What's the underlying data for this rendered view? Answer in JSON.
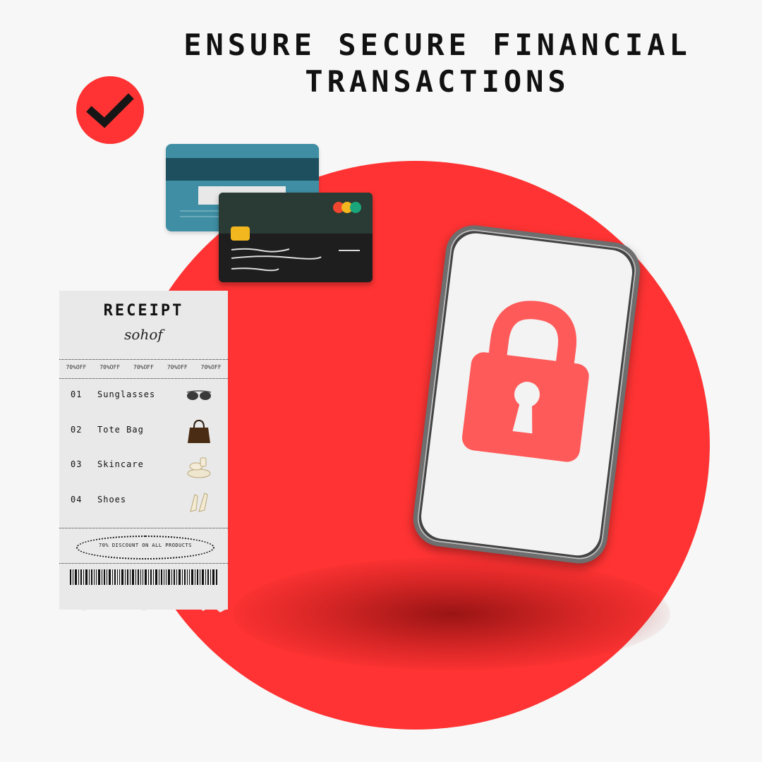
{
  "headline": {
    "line1": "ENSURE SECURE FINANCIAL",
    "line2": "TRANSACTIONS"
  },
  "colors": {
    "accent_red": "#ff3333",
    "lock_red": "#ff5a5a",
    "card_teal": "#3f8ea3",
    "card_black": "#1e1e1e"
  },
  "icons": {
    "badge": "checkmark-icon",
    "phone_screen": "padlock-icon"
  },
  "receipt": {
    "title": "RECEIPT",
    "brand": "sohof",
    "discount_tags": [
      "70%OFF",
      "70%OFF",
      "70%OFF",
      "70%OFF",
      "70%OFF"
    ],
    "items": [
      {
        "number": "01",
        "name": "Sunglasses",
        "icon": "sunglasses-icon"
      },
      {
        "number": "02",
        "name": "Tote Bag",
        "icon": "tote-bag-icon"
      },
      {
        "number": "03",
        "name": "Skincare",
        "icon": "skincare-icon"
      },
      {
        "number": "04",
        "name": "Shoes",
        "icon": "shoes-icon"
      }
    ],
    "footer_note": "70% DISCOUNT ON ALL PRODUCTS"
  }
}
